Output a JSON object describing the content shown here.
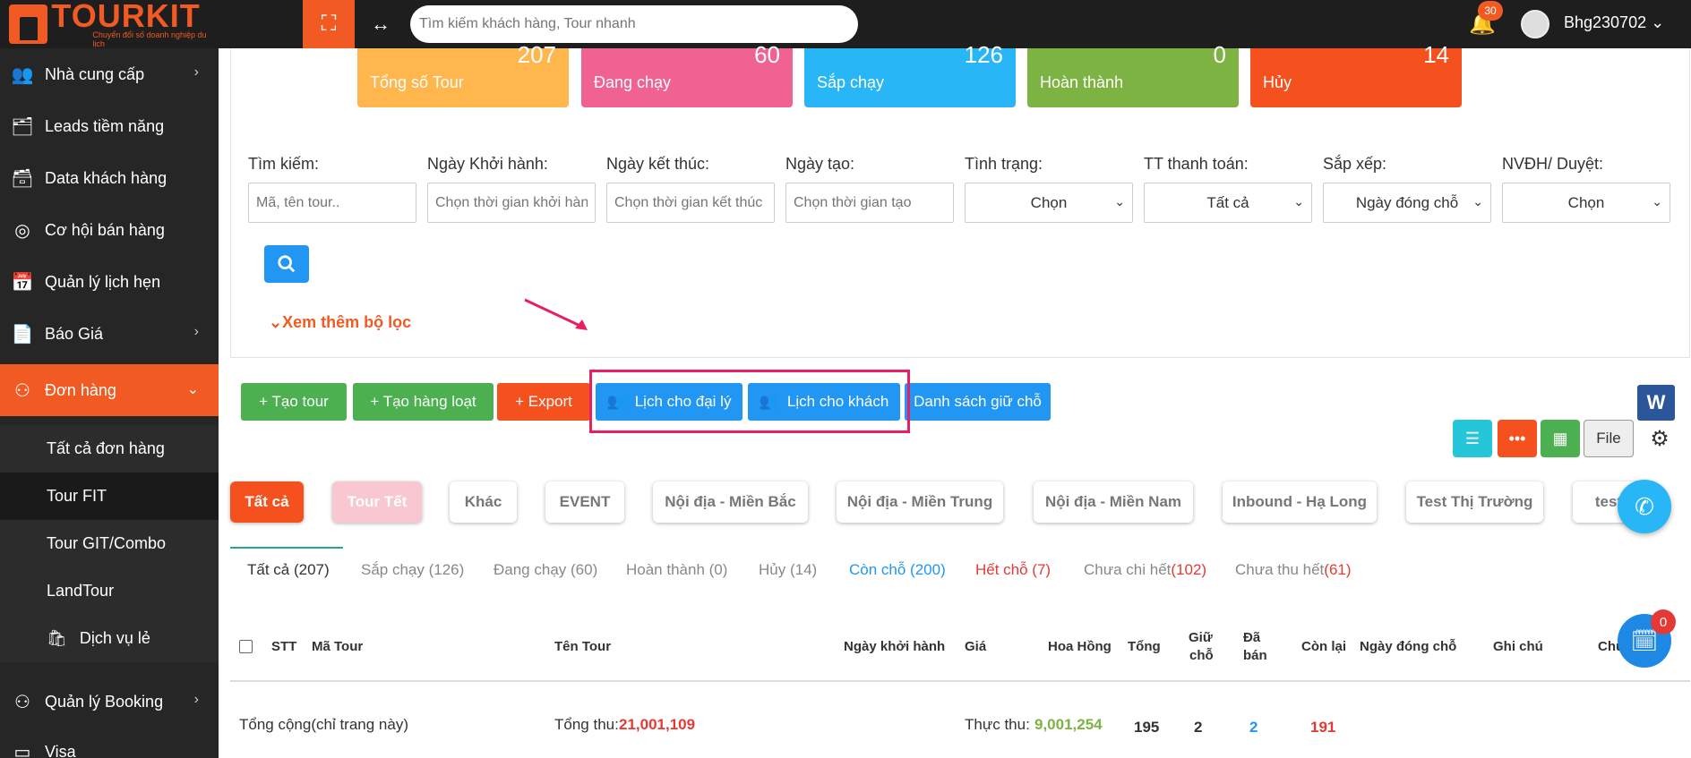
{
  "brand": {
    "name": "TOURKIT",
    "tagline": "Chuyển đổi số doanh nghiệp du lịch",
    "accent": "#f15a22"
  },
  "topbar": {
    "search_placeholder": "Tìm kiếm khách hàng, Tour nhanh",
    "notif_count": "30",
    "username": "Bhg230702 ⌄"
  },
  "sidebar": {
    "items": [
      {
        "label": "Nhà cung cấp",
        "icon": "users-icon",
        "chev": "›"
      },
      {
        "label": "Leads tiềm năng",
        "icon": "leads-icon"
      },
      {
        "label": "Data khách hàng",
        "icon": "data-icon"
      },
      {
        "label": "Cơ hội bán hàng",
        "icon": "opportunity-icon"
      },
      {
        "label": "Quản lý lịch hẹn",
        "icon": "cskh-icon"
      },
      {
        "label": "Báo Giá",
        "icon": "quote-icon",
        "chev": "›"
      },
      {
        "label": "Đơn hàng",
        "icon": "order-icon",
        "chev": "⌄"
      },
      {
        "label": "Quản lý Booking",
        "icon": "booking-icon",
        "chev": "›"
      },
      {
        "label": "Visa",
        "icon": "visa-icon"
      }
    ],
    "sub_items": [
      "Tất cả đơn hàng",
      "Tour FIT",
      "Tour GIT/Combo",
      "LandTour",
      "Dịch vụ lẻ"
    ]
  },
  "stats": [
    {
      "num": "207",
      "label": "Tổng số Tour",
      "color": "#ffb74d"
    },
    {
      "num": "60",
      "label": "Đang chạy",
      "color": "#f06292"
    },
    {
      "num": "126",
      "label": "Sắp chạy",
      "color": "#29b6f6"
    },
    {
      "num": "0",
      "label": "Hoàn thành",
      "color": "#7cb342"
    },
    {
      "num": "14",
      "label": "Hủy",
      "color": "#f4511e"
    }
  ],
  "filters": {
    "labels": [
      "Tìm kiếm:",
      "Ngày Khởi hành:",
      "Ngày kết thúc:",
      "Ngày tạo:",
      "Tình trạng:",
      "TT thanh toán:",
      "Sắp xếp:",
      "NVĐH/ Duyệt:"
    ],
    "placeholders": [
      "Mã, tên tour..",
      "Chọn thời gian khởi hành",
      "Chọn thời gian kết thúc",
      "Chọn thời gian tạo"
    ],
    "selects": [
      "Chọn",
      "Tất cả",
      "Ngày đóng chỗ",
      "Chọn"
    ],
    "more": "Xem thêm bộ lọc"
  },
  "actions": {
    "create_tour": "+ Tạo tour",
    "create_bulk": "+ Tạo hàng loạt",
    "export": "+ Export",
    "agent_calendar": "Lịch cho đại lý",
    "customer_calendar": "Lịch cho khách",
    "hold_list": "Danh sách giữ chỗ",
    "file": "File",
    "word": "W"
  },
  "categories": [
    "Tất cả",
    "Tour Tết",
    "Khác",
    "EVENT",
    "Nội địa - Miền Bắc",
    "Nội địa - Miền Trung",
    "Nội địa - Miền Nam",
    "Inbound - Hạ Long",
    "Test Thị Trường",
    "test"
  ],
  "status_tabs": {
    "all": "Tất cả (207)",
    "upcoming": "Sắp chạy (126)",
    "running": "Đang chạy (60)",
    "done": "Hoàn thành (0)",
    "cancel": "Hủy (14)",
    "available": "Còn chỗ (200)",
    "full": "Hết chỗ (7)",
    "unpaid_label": "Chưa chi hết",
    "unpaid_count": "(102)",
    "uncollected_label": "Chưa thu hết",
    "uncollected_count": "(61)"
  },
  "table": {
    "headers": {
      "stt": "STT",
      "code": "Mã Tour",
      "name": "Tên Tour",
      "date": "Ngày khởi hành",
      "price": "Giá",
      "commission": "Hoa Hồng",
      "total": "Tổng",
      "hold1": "Giữ",
      "hold2": "chỗ",
      "sold1": "Đã",
      "sold2": "bán",
      "remain": "Còn lại",
      "close": "Ngày đóng chỗ",
      "note": "Ghi chú",
      "more": "Chú"
    },
    "totals": {
      "label": "Tổng cộng(chỉ trang này)",
      "revenue_label": "Tổng thu:",
      "revenue": "21,001,109",
      "real_label": "Thực thu:",
      "real": "9,001,254",
      "total": "195",
      "hold": "2",
      "sold": "2",
      "remain": "191"
    }
  },
  "floating": {
    "cart_count": "0"
  }
}
